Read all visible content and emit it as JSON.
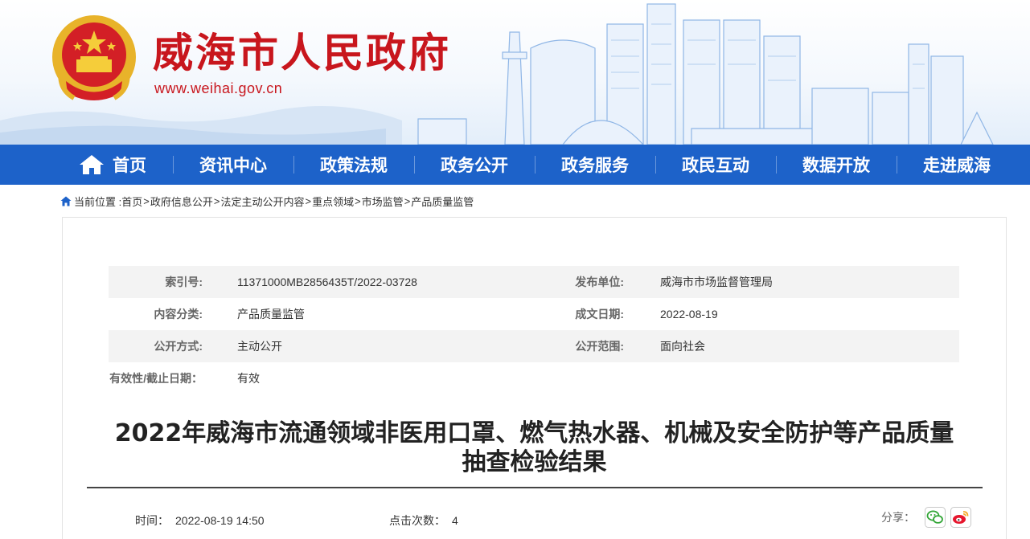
{
  "header": {
    "site_title": "威海市人民政府",
    "site_url": "www.weihai.gov.cn",
    "brand_color": "#c8161d"
  },
  "nav": {
    "color": "#1d62c9",
    "items": [
      {
        "label": "首页",
        "icon": "home-icon"
      },
      {
        "label": "资讯中心"
      },
      {
        "label": "政策法规"
      },
      {
        "label": "政务公开"
      },
      {
        "label": "政务服务"
      },
      {
        "label": "政民互动"
      },
      {
        "label": "数据开放"
      },
      {
        "label": "走进威海"
      }
    ]
  },
  "breadcrumb": {
    "prefix": "当前位置 :",
    "items": [
      "首页",
      "政府信息公开",
      "法定主动公开内容",
      "重点领域",
      "市场监管",
      "产品质量监管"
    ],
    "separator": ">"
  },
  "meta": {
    "index_label": "索引号:",
    "index_value": "11371000MB2856435T/2022-03728",
    "publisher_label": "发布单位:",
    "publisher_value": "威海市市场监督管理局",
    "category_label": "内容分类:",
    "category_value": "产品质量监管",
    "date_label": "成文日期:",
    "date_value": "2022-08-19",
    "mode_label": "公开方式:",
    "mode_value": "主动公开",
    "scope_label": "公开范围:",
    "scope_value": "面向社会",
    "validity_label": "有效性/截止日期：",
    "validity_value": "有效"
  },
  "article": {
    "title_line1": "2022年威海市流通领域非医用口罩、燃气热水器、机械及安全防护等产品质量",
    "title_line2": "抽查检验结果",
    "time_label": "时间：",
    "time_value": "2022-08-19 14:50",
    "clicks_label": "点击次数：",
    "clicks_value": "4"
  },
  "share": {
    "label": "分享：",
    "buttons": [
      "wechat-icon",
      "weibo-icon"
    ]
  }
}
